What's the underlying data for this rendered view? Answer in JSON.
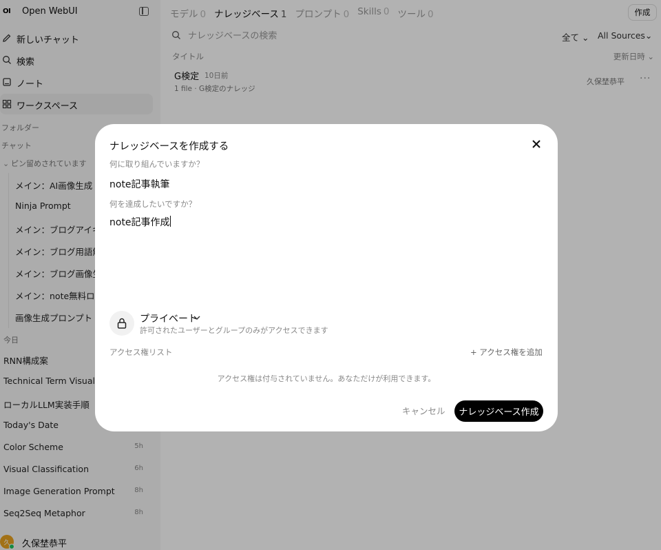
{
  "sidebar": {
    "logo": "OI",
    "app_name": "Open WebUI",
    "nav": [
      {
        "label": "新しいチャット",
        "icon": "pencil-icon"
      },
      {
        "label": "検索",
        "icon": "search-icon"
      },
      {
        "label": "ノート",
        "icon": "note-icon"
      },
      {
        "label": "ワークスペース",
        "icon": "grid-icon"
      }
    ],
    "folders_label": "フォルダー",
    "chats_label": "チャット",
    "pinned_label": "ピン留めされています",
    "pinned": [
      "メイン：AI画像生成",
      "Ninja Prompt",
      "メイン：ブログアイキャッ",
      "メイン：ブログ用語解説",
      "メイン：ブログ画像生成",
      "メイン：note無料ロー",
      "画像生成プロンプト"
    ],
    "today_label": "今日",
    "chats": [
      {
        "title": "RNN構成案",
        "time": ""
      },
      {
        "title": "Technical Term Visual",
        "time": ""
      },
      {
        "title": "ローカルLLM実装手順",
        "time": ""
      },
      {
        "title": "Today's Date",
        "time": ""
      },
      {
        "title": "Color Scheme",
        "time": "5h"
      },
      {
        "title": "Visual Classification",
        "time": "6h"
      },
      {
        "title": "Image Generation Prompt",
        "time": "8h"
      },
      {
        "title": "Seq2Seq Metaphor",
        "time": "8h"
      }
    ],
    "user": {
      "initial": "久",
      "name": "久保埜恭平"
    }
  },
  "main": {
    "tabs": [
      {
        "label": "モデル",
        "count": "0"
      },
      {
        "label": "ナレッジベース",
        "count": "1"
      },
      {
        "label": "プロンプト",
        "count": "0"
      },
      {
        "label": "Skills",
        "count": "0"
      },
      {
        "label": "ツール",
        "count": "0"
      }
    ],
    "create_label": "作成",
    "search_placeholder": "ナレッジベースの検索",
    "filter_all": "全て",
    "filter_sources": "All Sources",
    "col_title": "タイトル",
    "col_updated": "更新日時",
    "kb": {
      "name": "G検定",
      "time": "10日前",
      "desc": "1 file · G検定のナレッジ",
      "owner": "久保埜恭平",
      "more": "···"
    }
  },
  "modal": {
    "title": "ナレッジベースを作成する",
    "q1_label": "何に取り組んでいますか？",
    "q1_value": "note記事執筆",
    "q2_label": "何を達成したいですか？",
    "q2_value": "note記事作成",
    "access_type": "プライベート",
    "access_desc": "許可されたユーザーとグループのみがアクセスできます",
    "access_list_label": "アクセス権リスト",
    "add_access": "+ アクセス権を追加",
    "no_access": "アクセス権は付与されていません。あなただけが利用できます。",
    "cancel": "キャンセル",
    "submit": "ナレッジベース作成"
  }
}
